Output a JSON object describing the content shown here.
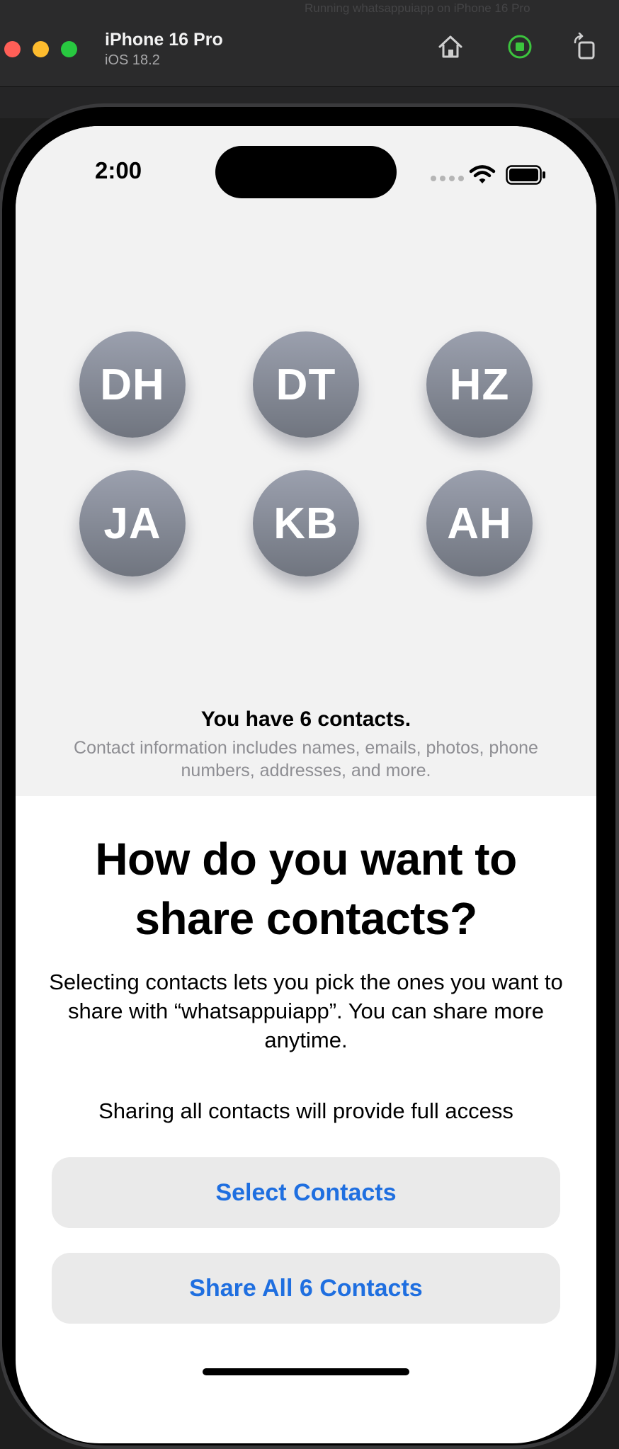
{
  "simulator": {
    "ghost_title": "Running whatsappuiapp on iPhone 16 Pro",
    "device_name": "iPhone 16 Pro",
    "os_version": "iOS 18.2",
    "icons": [
      "home-icon",
      "record-icon",
      "rotate-icon"
    ],
    "traffic_colors": [
      "#ff5f57",
      "#febc2e",
      "#28c840"
    ]
  },
  "status_bar": {
    "time": "2:00",
    "icons": [
      "signal-dots-icon",
      "wifi-icon",
      "battery-icon"
    ]
  },
  "contacts_preview": {
    "avatars": [
      "DH",
      "DT",
      "HZ",
      "JA",
      "KB",
      "AH"
    ],
    "summary_title": "You have 6 contacts.",
    "summary_detail": "Contact information includes names, emails, photos, phone numbers, addresses, and more."
  },
  "sheet": {
    "heading": "How do you want to share contacts?",
    "body": "Selecting contacts lets you pick the ones you want to share with “whatsappuiapp”. You can share more anytime.",
    "secondary": "Sharing all contacts will provide full access",
    "select_button": "Select Contacts",
    "share_all_button": "Share All 6 Contacts"
  },
  "colors": {
    "accent": "#1f6fe0",
    "button_bg": "#eaeaea",
    "avatar_top": "#9ba0ae",
    "avatar_bottom": "#70757f"
  }
}
